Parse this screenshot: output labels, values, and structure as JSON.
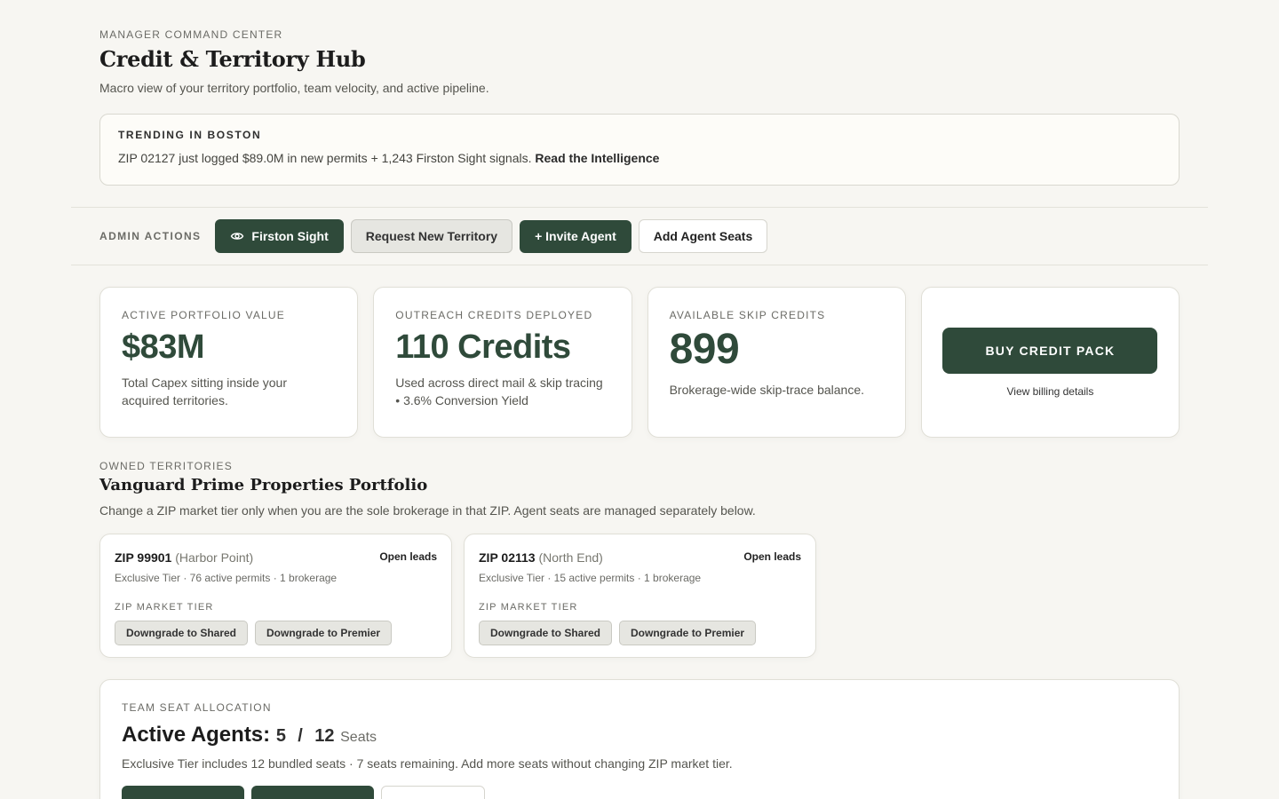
{
  "header": {
    "eyebrow": "MANAGER COMMAND CENTER",
    "title": "Credit & Territory Hub",
    "subtitle": "Macro view of your territory portfolio, team velocity, and active pipeline."
  },
  "trending": {
    "label": "TRENDING IN BOSTON",
    "text": "ZIP 02127 just logged $89.0M in new permits + 1,243 Firston Sight signals.",
    "link": "Read the Intelligence"
  },
  "admin": {
    "label": "ADMIN ACTIONS",
    "firston_sight": "Firston Sight",
    "request_territory": "Request New Territory",
    "invite_agent": "+ Invite Agent",
    "add_seats": "Add Agent Seats"
  },
  "stats": [
    {
      "label": "ACTIVE PORTFOLIO VALUE",
      "value": "$83M",
      "desc": "Total Capex sitting inside your acquired territories."
    },
    {
      "label": "OUTREACH CREDITS DEPLOYED",
      "value": "110 Credits",
      "desc": "Used across direct mail & skip tracing • 3.6% Conversion Yield"
    },
    {
      "label": "AVAILABLE SKIP CREDITS",
      "value": "899",
      "desc": "Brokerage-wide skip-trace balance."
    }
  ],
  "buy": {
    "button": "BUY CREDIT PACK",
    "link": "View billing details"
  },
  "owned": {
    "eyebrow": "OWNED TERRITORIES",
    "title": "Vanguard Prime Properties Portfolio",
    "subtitle": "Change a ZIP market tier only when you are the sole brokerage in that ZIP. Agent seats are managed separately below."
  },
  "zips": [
    {
      "zip": "ZIP 99901",
      "area": "(Harbor Point)",
      "status": "Open leads",
      "meta": "Exclusive Tier · 76 active permits · 1 brokerage",
      "tier_label": "ZIP MARKET TIER",
      "btn1": "Downgrade to Shared",
      "btn2": "Downgrade to Premier"
    },
    {
      "zip": "ZIP 02113",
      "area": "(North End)",
      "status": "Open leads",
      "meta": "Exclusive Tier · 15 active permits · 1 brokerage",
      "tier_label": "ZIP MARKET TIER",
      "btn1": "Downgrade to Shared",
      "btn2": "Downgrade to Premier"
    }
  ],
  "seats": {
    "eyebrow": "TEAM SEAT ALLOCATION",
    "heading": "Active Agents:",
    "active": "5",
    "slash": "/",
    "total": "12",
    "unit": "Seats",
    "desc": "Exclusive Tier includes 12 bundled seats · 7 seats remaining. Add more seats without changing ZIP market tier."
  },
  "colors": {
    "accent": "#2f4a3a",
    "background": "#f7f6f2"
  }
}
